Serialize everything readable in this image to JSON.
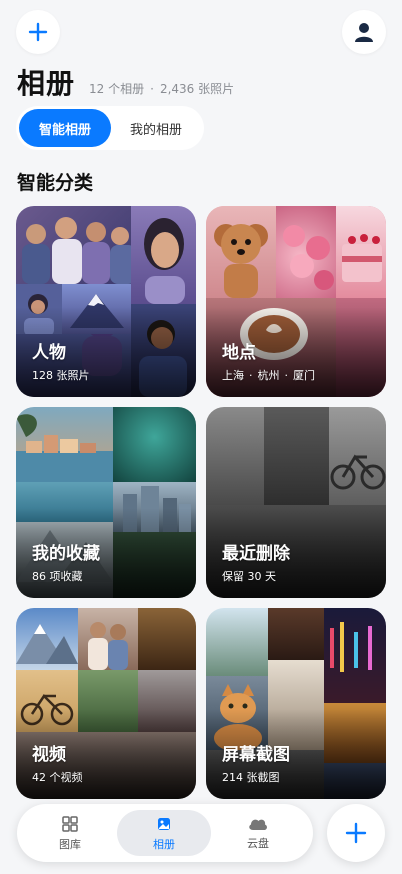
{
  "header": {
    "title": "相册",
    "album_count": "12 个相册",
    "photo_count": "2,436 张照片"
  },
  "segment": {
    "smart": "智能相册",
    "mine": "我的相册"
  },
  "section": {
    "title": "智能分类"
  },
  "cards": {
    "people": {
      "title": "人物",
      "sub": "128 张照片"
    },
    "places": {
      "title": "地点",
      "places": [
        "上海",
        "杭州",
        "厦门"
      ]
    },
    "favorites": {
      "title": "我的收藏",
      "sub": "86 项收藏"
    },
    "deleted": {
      "title": "最近删除",
      "sub": "保留 30 天"
    },
    "videos": {
      "title": "视频",
      "sub": "42 个视频"
    },
    "screenshots": {
      "title": "屏幕截图",
      "sub": "214 张截图"
    }
  },
  "tabbar": {
    "library": "图库",
    "albums": "相册",
    "cloud": "云盘"
  },
  "colors": {
    "accent": "#0a7aff",
    "background": "#f5f6f8"
  },
  "icons": [
    "plus-icon",
    "user-icon",
    "grid-icon",
    "album-icon",
    "cloud-icon"
  ]
}
